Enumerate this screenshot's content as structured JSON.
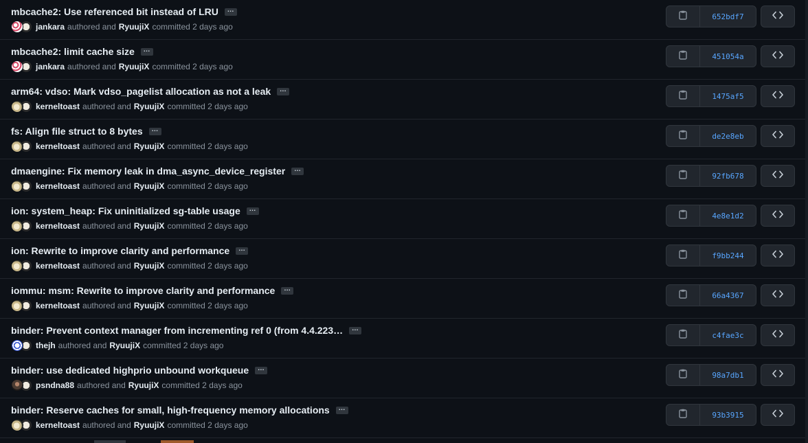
{
  "commits": [
    {
      "title": "mbcache2: Use referenced bit instead of LRU",
      "author": "jankara",
      "committer": "RyuujiX",
      "authored_text": "authored and",
      "committed_text": "committed 2 days ago",
      "sha": "652bdf7",
      "avatar": "pink-pattern"
    },
    {
      "title": "mbcache2: limit cache size",
      "author": "jankara",
      "committer": "RyuujiX",
      "authored_text": "authored and",
      "committed_text": "committed 2 days ago",
      "sha": "451054a",
      "avatar": "pink-pattern"
    },
    {
      "title": "arm64: vdso: Mark vdso_pagelist allocation as not a leak",
      "author": "kerneltoast",
      "committer": "RyuujiX",
      "authored_text": "authored and",
      "committed_text": "committed 2 days ago",
      "sha": "1475af5",
      "avatar": "beige-photo"
    },
    {
      "title": "fs: Align file struct to 8 bytes",
      "author": "kerneltoast",
      "committer": "RyuujiX",
      "authored_text": "authored and",
      "committed_text": "committed 2 days ago",
      "sha": "de2e8eb",
      "avatar": "beige-photo"
    },
    {
      "title": "dmaengine: Fix memory leak in dma_async_device_register",
      "author": "kerneltoast",
      "committer": "RyuujiX",
      "authored_text": "authored and",
      "committed_text": "committed 2 days ago",
      "sha": "92fb678",
      "avatar": "beige-photo"
    },
    {
      "title": "ion: system_heap: Fix uninitialized sg-table usage",
      "author": "kerneltoast",
      "committer": "RyuujiX",
      "authored_text": "authored and",
      "committed_text": "committed 2 days ago",
      "sha": "4e8e1d2",
      "avatar": "beige-photo"
    },
    {
      "title": "ion: Rewrite to improve clarity and performance",
      "author": "kerneltoast",
      "committer": "RyuujiX",
      "authored_text": "authored and",
      "committed_text": "committed 2 days ago",
      "sha": "f9bb244",
      "avatar": "beige-photo"
    },
    {
      "title": "iommu: msm: Rewrite to improve clarity and performance",
      "author": "kerneltoast",
      "committer": "RyuujiX",
      "authored_text": "authored and",
      "committed_text": "committed 2 days ago",
      "sha": "66a4367",
      "avatar": "beige-photo"
    },
    {
      "title": "binder: Prevent context manager from incrementing ref 0 (from 4.4.223…",
      "author": "thejh",
      "committer": "RyuujiX",
      "authored_text": "authored and",
      "committed_text": "committed 2 days ago",
      "sha": "c4fae3c",
      "avatar": "blue-pattern"
    },
    {
      "title": "binder: use dedicated highprio unbound workqueue",
      "author": "psndna88",
      "committer": "RyuujiX",
      "authored_text": "authored and",
      "committed_text": "committed 2 days ago",
      "sha": "98a7db1",
      "avatar": "dark-photo"
    },
    {
      "title": "binder: Reserve caches for small, high-frequency memory allocations",
      "author": "kerneltoast",
      "committer": "RyuujiX",
      "authored_text": "authored and",
      "committed_text": "committed 2 days ago",
      "sha": "93b3915",
      "avatar": "beige-photo"
    }
  ],
  "ellipsis_label": "…",
  "icons": {
    "copy": "clipboard-icon",
    "browse": "code-icon"
  },
  "colors": {
    "background": "#0d1117",
    "sha": "#58a6ff",
    "border": "#30363d"
  }
}
